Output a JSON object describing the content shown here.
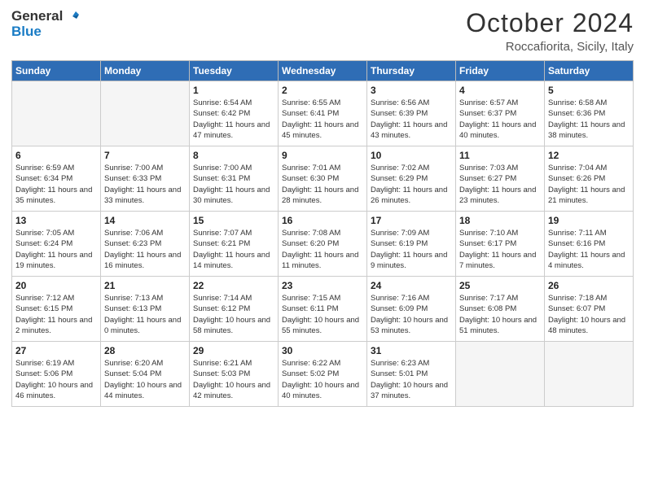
{
  "logo": {
    "text1": "General",
    "text2": "Blue"
  },
  "title": "October 2024",
  "location": "Roccafiorita, Sicily, Italy",
  "days_of_week": [
    "Sunday",
    "Monday",
    "Tuesday",
    "Wednesday",
    "Thursday",
    "Friday",
    "Saturday"
  ],
  "weeks": [
    [
      {
        "day": "",
        "info": ""
      },
      {
        "day": "",
        "info": ""
      },
      {
        "day": "1",
        "sunrise": "6:54 AM",
        "sunset": "6:42 PM",
        "daylight": "11 hours and 47 minutes."
      },
      {
        "day": "2",
        "sunrise": "6:55 AM",
        "sunset": "6:41 PM",
        "daylight": "11 hours and 45 minutes."
      },
      {
        "day": "3",
        "sunrise": "6:56 AM",
        "sunset": "6:39 PM",
        "daylight": "11 hours and 43 minutes."
      },
      {
        "day": "4",
        "sunrise": "6:57 AM",
        "sunset": "6:37 PM",
        "daylight": "11 hours and 40 minutes."
      },
      {
        "day": "5",
        "sunrise": "6:58 AM",
        "sunset": "6:36 PM",
        "daylight": "11 hours and 38 minutes."
      }
    ],
    [
      {
        "day": "6",
        "sunrise": "6:59 AM",
        "sunset": "6:34 PM",
        "daylight": "11 hours and 35 minutes."
      },
      {
        "day": "7",
        "sunrise": "7:00 AM",
        "sunset": "6:33 PM",
        "daylight": "11 hours and 33 minutes."
      },
      {
        "day": "8",
        "sunrise": "7:00 AM",
        "sunset": "6:31 PM",
        "daylight": "11 hours and 30 minutes."
      },
      {
        "day": "9",
        "sunrise": "7:01 AM",
        "sunset": "6:30 PM",
        "daylight": "11 hours and 28 minutes."
      },
      {
        "day": "10",
        "sunrise": "7:02 AM",
        "sunset": "6:29 PM",
        "daylight": "11 hours and 26 minutes."
      },
      {
        "day": "11",
        "sunrise": "7:03 AM",
        "sunset": "6:27 PM",
        "daylight": "11 hours and 23 minutes."
      },
      {
        "day": "12",
        "sunrise": "7:04 AM",
        "sunset": "6:26 PM",
        "daylight": "11 hours and 21 minutes."
      }
    ],
    [
      {
        "day": "13",
        "sunrise": "7:05 AM",
        "sunset": "6:24 PM",
        "daylight": "11 hours and 19 minutes."
      },
      {
        "day": "14",
        "sunrise": "7:06 AM",
        "sunset": "6:23 PM",
        "daylight": "11 hours and 16 minutes."
      },
      {
        "day": "15",
        "sunrise": "7:07 AM",
        "sunset": "6:21 PM",
        "daylight": "11 hours and 14 minutes."
      },
      {
        "day": "16",
        "sunrise": "7:08 AM",
        "sunset": "6:20 PM",
        "daylight": "11 hours and 11 minutes."
      },
      {
        "day": "17",
        "sunrise": "7:09 AM",
        "sunset": "6:19 PM",
        "daylight": "11 hours and 9 minutes."
      },
      {
        "day": "18",
        "sunrise": "7:10 AM",
        "sunset": "6:17 PM",
        "daylight": "11 hours and 7 minutes."
      },
      {
        "day": "19",
        "sunrise": "7:11 AM",
        "sunset": "6:16 PM",
        "daylight": "11 hours and 4 minutes."
      }
    ],
    [
      {
        "day": "20",
        "sunrise": "7:12 AM",
        "sunset": "6:15 PM",
        "daylight": "11 hours and 2 minutes."
      },
      {
        "day": "21",
        "sunrise": "7:13 AM",
        "sunset": "6:13 PM",
        "daylight": "11 hours and 0 minutes."
      },
      {
        "day": "22",
        "sunrise": "7:14 AM",
        "sunset": "6:12 PM",
        "daylight": "10 hours and 58 minutes."
      },
      {
        "day": "23",
        "sunrise": "7:15 AM",
        "sunset": "6:11 PM",
        "daylight": "10 hours and 55 minutes."
      },
      {
        "day": "24",
        "sunrise": "7:16 AM",
        "sunset": "6:09 PM",
        "daylight": "10 hours and 53 minutes."
      },
      {
        "day": "25",
        "sunrise": "7:17 AM",
        "sunset": "6:08 PM",
        "daylight": "10 hours and 51 minutes."
      },
      {
        "day": "26",
        "sunrise": "7:18 AM",
        "sunset": "6:07 PM",
        "daylight": "10 hours and 48 minutes."
      }
    ],
    [
      {
        "day": "27",
        "sunrise": "6:19 AM",
        "sunset": "5:06 PM",
        "daylight": "10 hours and 46 minutes."
      },
      {
        "day": "28",
        "sunrise": "6:20 AM",
        "sunset": "5:04 PM",
        "daylight": "10 hours and 44 minutes."
      },
      {
        "day": "29",
        "sunrise": "6:21 AM",
        "sunset": "5:03 PM",
        "daylight": "10 hours and 42 minutes."
      },
      {
        "day": "30",
        "sunrise": "6:22 AM",
        "sunset": "5:02 PM",
        "daylight": "10 hours and 40 minutes."
      },
      {
        "day": "31",
        "sunrise": "6:23 AM",
        "sunset": "5:01 PM",
        "daylight": "10 hours and 37 minutes."
      },
      {
        "day": "",
        "info": ""
      },
      {
        "day": "",
        "info": ""
      }
    ]
  ]
}
